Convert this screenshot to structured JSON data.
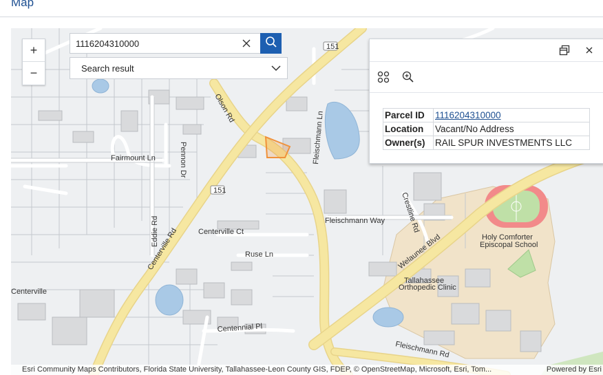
{
  "header": {
    "title": "Map"
  },
  "zoom": {
    "in_label": "+",
    "out_label": "−"
  },
  "search": {
    "value": "1116204310000",
    "placeholder": ""
  },
  "result_dropdown": {
    "label": "Search result"
  },
  "popup": {
    "fields": [
      {
        "key": "Parcel ID",
        "value": "1116204310000"
      },
      {
        "key": "Location",
        "value": "Vacant/No Address"
      },
      {
        "key": "Owner(s)",
        "value": "RAIL SPUR INVESTMENTS LLC"
      }
    ]
  },
  "map_labels": {
    "olson_rd": "Olson Rd",
    "fleischmann_ln": "Fleischmann Ln",
    "fleischmann_way": "Fleischmann Way",
    "fleischmann_rd": "Fleischmann Rd",
    "welaunee_blvd": "Welaunee Blvd",
    "centerville_rd": "Centerville Rd",
    "centerville_ct": "Centerville Ct",
    "centerville": "Centerville",
    "eddie_rd": "Eddie Rd",
    "pennon_dr": "Pennon Dr",
    "fairmount_ln": "Fairmount Ln",
    "crestline_rd": "Crestline Rd",
    "ruse_ln": "Ruse Ln",
    "centennial_pl": "Centennial Pl",
    "holy_comforter": "Holy Comforter",
    "episcopal_school": "Episcopal School",
    "tallahassee": "Tallahassee",
    "orthopedic_clinic": "Orthopedic Clinic",
    "shield_151_a": "151",
    "shield_151_b": "151"
  },
  "attribution": {
    "text": "Esri Community Maps Contributors, Florida State University, Tallahassee-Leon County GIS, FDEP, © OpenStreetMap, Microsoft, Esri, Tom...",
    "powered": "Powered by Esri"
  },
  "colors": {
    "accent": "#1d5fb1",
    "title": "#1d4f91",
    "road_major": "#f6e7a1",
    "water": "#a9c9e6",
    "parcel_highlight": "#f0913a",
    "school_ground": "#f1e3c9",
    "track": "#f28a8a",
    "field": "#bfe0a7"
  }
}
